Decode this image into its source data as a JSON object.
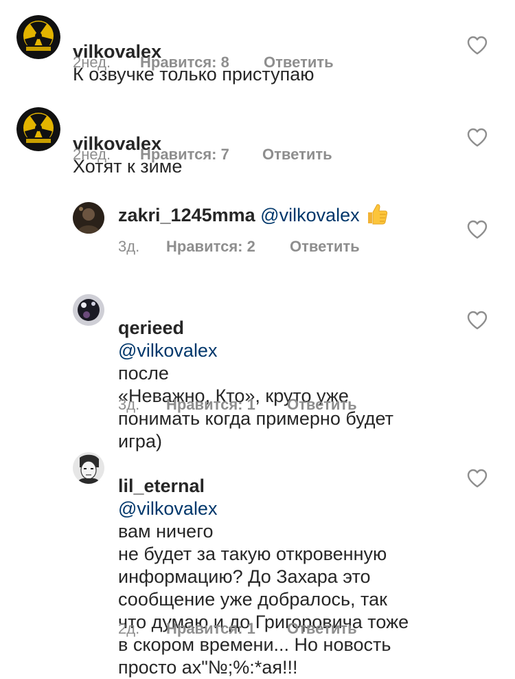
{
  "comments": [
    {
      "username": "vilkovalex",
      "mention": "",
      "text": "К озвучке только приступаю",
      "time": "2нед.",
      "likes": "Нравится: 8",
      "reply": "Ответить",
      "avatar": "stalker-radiation-avatar"
    },
    {
      "username": "vilkovalex",
      "mention": "",
      "text": "Хотят к зиме",
      "time": "2нед.",
      "likes": "Нравится: 7",
      "reply": "Ответить",
      "avatar": "stalker-radiation-avatar"
    },
    {
      "username": "zakri_1245mma",
      "mention": "@vilkovalex",
      "text": "",
      "emoji": "thumbs-up",
      "time": "3д.",
      "likes": "Нравится: 2",
      "reply": "Ответить",
      "avatar": "dark-photo-avatar"
    },
    {
      "username": "qerieed",
      "mention": "@vilkovalex",
      "text": "после\n«Неважно, Кто», круто уже\nпонимать когда примерно будет\nигра)",
      "time": "3д.",
      "likes": "Нравится: 1",
      "reply": "Ответить",
      "avatar": "night-photo-avatar"
    },
    {
      "username": "lil_eternal",
      "mention": "@vilkovalex",
      "text": "вам ничего\nне будет за такую откровенную\nинформацию? До Захара это\nсообщение уже добралось, так\nчто думаю и до Григоровича тоже\nв скором времени... Но новость\nпросто ах\"№;%:*ая!!!",
      "time": "2д.",
      "likes": "Нравится: 1",
      "reply": "Ответить",
      "avatar": "sketch-face-avatar"
    }
  ],
  "icons": {
    "like": "heart-outline-icon"
  },
  "colors": {
    "text": "#262626",
    "mention": "#00376b",
    "meta": "#8e8e8e"
  }
}
